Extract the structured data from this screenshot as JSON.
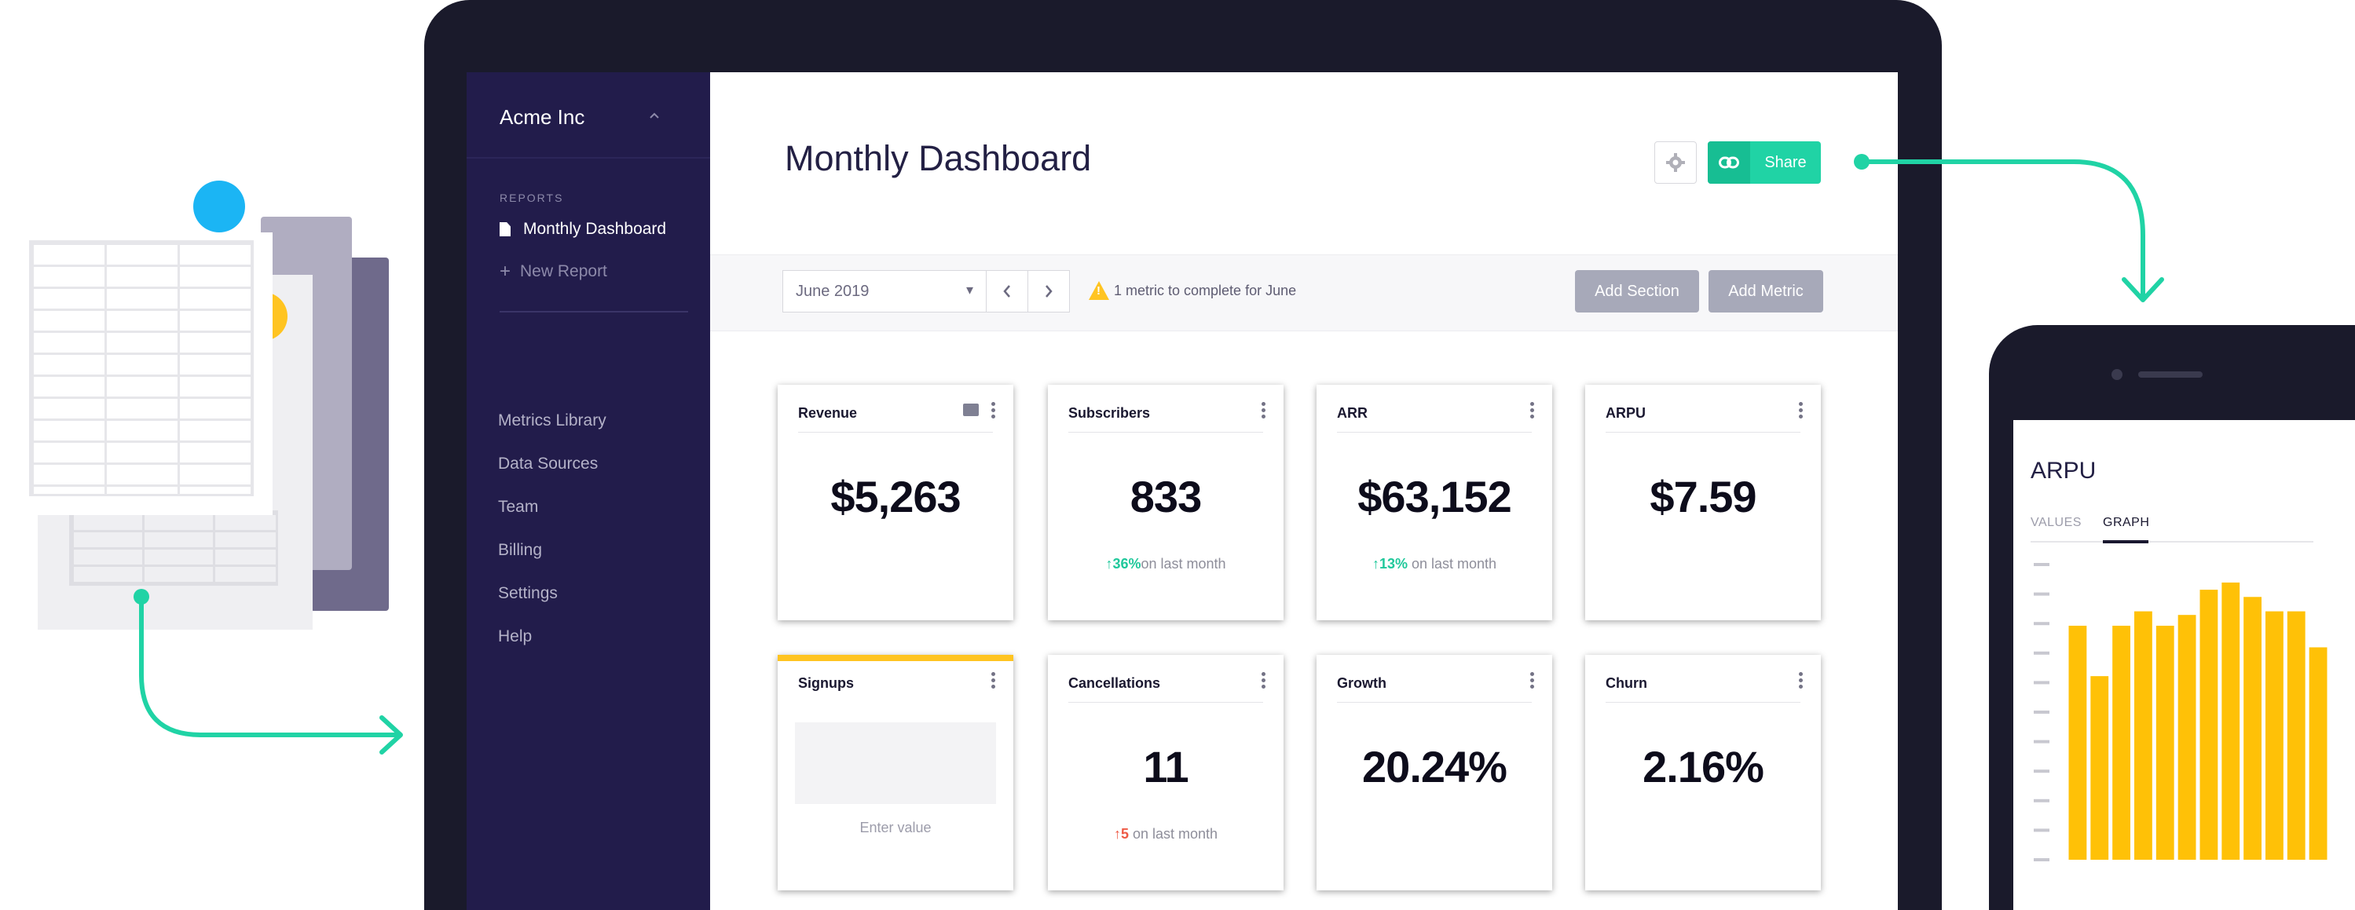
{
  "sidebar": {
    "org_name": "Acme Inc",
    "section_label": "REPORTS",
    "report_item": "Monthly Dashboard",
    "new_report": "New Report",
    "links": [
      "Metrics Library",
      "Data Sources",
      "Team",
      "Billing",
      "Settings",
      "Help"
    ]
  },
  "header": {
    "title": "Monthly Dashboard",
    "share_label": "Share"
  },
  "toolbar": {
    "month": "June 2019",
    "warning": "1 metric to complete for June",
    "add_section": "Add Section",
    "add_metric": "Add Metric"
  },
  "cards": [
    {
      "title": "Revenue",
      "value": "$5,263"
    },
    {
      "title": "Subscribers",
      "value": "833",
      "change": "36%",
      "change_suffix": "on last month"
    },
    {
      "title": "ARR",
      "value": "$63,152",
      "change": "13%",
      "change_suffix": " on last month"
    },
    {
      "title": "ARPU",
      "value": "$7.59"
    },
    {
      "title": "Signups",
      "placeholder": "Enter value"
    },
    {
      "title": "Cancellations",
      "value": "11",
      "change": "5",
      "change_suffix": " on last month"
    },
    {
      "title": "Growth",
      "value": "20.24%"
    },
    {
      "title": "Churn",
      "value": "2.16%"
    }
  ],
  "phone": {
    "title": "ARPU",
    "tabs": [
      "VALUES",
      "GRAPH"
    ],
    "active_tab": "GRAPH"
  },
  "colors": {
    "sidebar": "#221c4b",
    "accent": "#20d3a5",
    "warning": "#ffc421",
    "negative": "#ee5a45",
    "bar": "#ffc107"
  },
  "chart_data": {
    "type": "bar",
    "title": "ARPU",
    "values": [
      6.5,
      5.1,
      6.5,
      6.9,
      6.5,
      6.8,
      7.5,
      7.7,
      7.3,
      6.9,
      6.9,
      5.9
    ],
    "ylim": [
      0,
      8.2
    ],
    "grid": false
  }
}
